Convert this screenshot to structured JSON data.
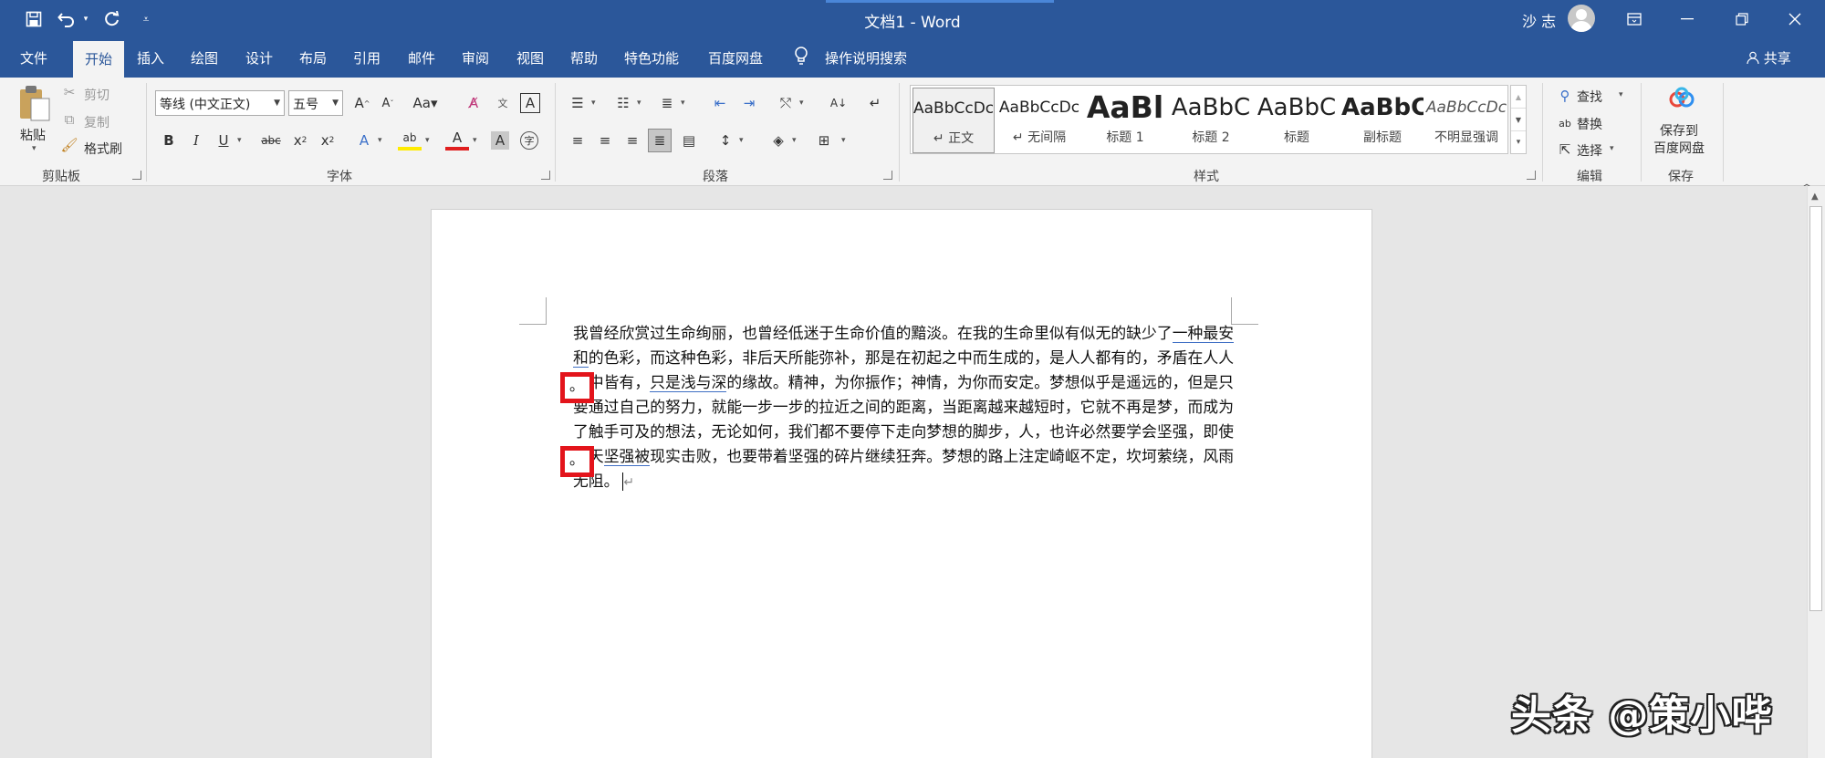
{
  "window": {
    "title": "文档1  -  Word",
    "user": "沙 志"
  },
  "quick_access": {
    "icons": [
      "save-icon",
      "undo-icon",
      "redo-icon",
      "customize-icon"
    ]
  },
  "tabs": [
    "文件",
    "开始",
    "插入",
    "绘图",
    "设计",
    "布局",
    "引用",
    "邮件",
    "审阅",
    "视图",
    "帮助",
    "特色功能",
    "百度网盘"
  ],
  "tell_me": "操作说明搜索",
  "share": "共享",
  "clipboard": {
    "paste": "粘贴",
    "cut": "剪切",
    "copy": "复制",
    "format_painter": "格式刷",
    "label": "剪贴板"
  },
  "font": {
    "name": "等线 (中文正文)",
    "size": "五号",
    "label": "字体"
  },
  "paragraph": {
    "label": "段落"
  },
  "styles": {
    "label": "样式",
    "items": [
      {
        "preview": "AaBbCcDc",
        "name": "↵ 正文"
      },
      {
        "preview": "AaBbCcDc",
        "name": "↵ 无间隔"
      },
      {
        "preview": "AaBl",
        "name": "标题 1"
      },
      {
        "preview": "AaBbC",
        "name": "标题 2"
      },
      {
        "preview": "AaBbC",
        "name": "标题"
      },
      {
        "preview": "AaBbC",
        "name": "副标题"
      },
      {
        "preview": "AaBbCcDc",
        "name": "不明显强调"
      }
    ]
  },
  "editing": {
    "find": "查找",
    "replace": "替换",
    "select": "选择",
    "label": "编辑"
  },
  "save": {
    "button": "保存到\n百度网盘",
    "label": "保存"
  },
  "document": {
    "p1": "我曾经欣赏过生命绚丽，也曾经低迷于生命价值的黯淡。在我的生命里似有似无的缺少了",
    "u1": "一种最安和",
    "p2": "的色彩，而这种色彩，非后天所能弥补，那是在初起之中而生成的，是人人都有的，矛盾在人人之中皆有，",
    "u2": "只是浅与深",
    "p3": "的缘故。精神，为你振作；神情，为你而安定。梦想似乎是遥远的，但是只要通过自己的努力，就能一步一步的拉近之间的距离，当距离越来越短时，它就不再是梦，而成为了触手可及的想法，无论如何，我们都不要停下走向梦想的脚步，人，也许必然要学会坚强，即使有天",
    "u3": "坚强被",
    "p4": "现实击败，也要带着坚强的碎片继续狂奔。梦想的路上注定崎岖不定，坎坷萦绕，风雨无阻。",
    "highlight_char": "。"
  },
  "watermark": "头条 @策小哔"
}
